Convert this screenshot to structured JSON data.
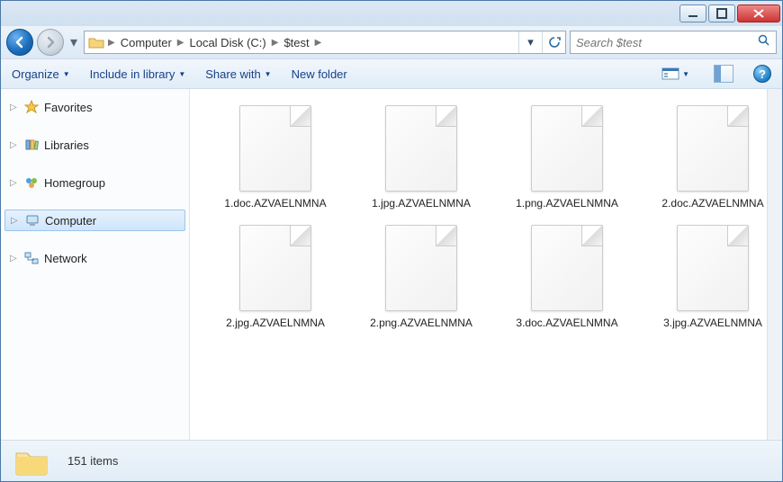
{
  "breadcrumb": {
    "seg0": "Computer",
    "seg1": "Local Disk (C:)",
    "seg2": "$test"
  },
  "search": {
    "placeholder": "Search $test"
  },
  "toolbar": {
    "organize": "Organize",
    "include": "Include in library",
    "share": "Share with",
    "newfolder": "New folder"
  },
  "sidebar": {
    "favorites": "Favorites",
    "libraries": "Libraries",
    "homegroup": "Homegroup",
    "computer": "Computer",
    "network": "Network"
  },
  "files": {
    "f0": "1.doc.AZVAELNMNA",
    "f1": "1.jpg.AZVAELNMNA",
    "f2": "1.png.AZVAELNMNA",
    "f3": "2.doc.AZVAELNMNA",
    "f4": "2.jpg.AZVAELNMNA",
    "f5": "2.png.AZVAELNMNA",
    "f6": "3.doc.AZVAELNMNA",
    "f7": "3.jpg.AZVAELNMNA"
  },
  "status": {
    "count": "151 items"
  }
}
